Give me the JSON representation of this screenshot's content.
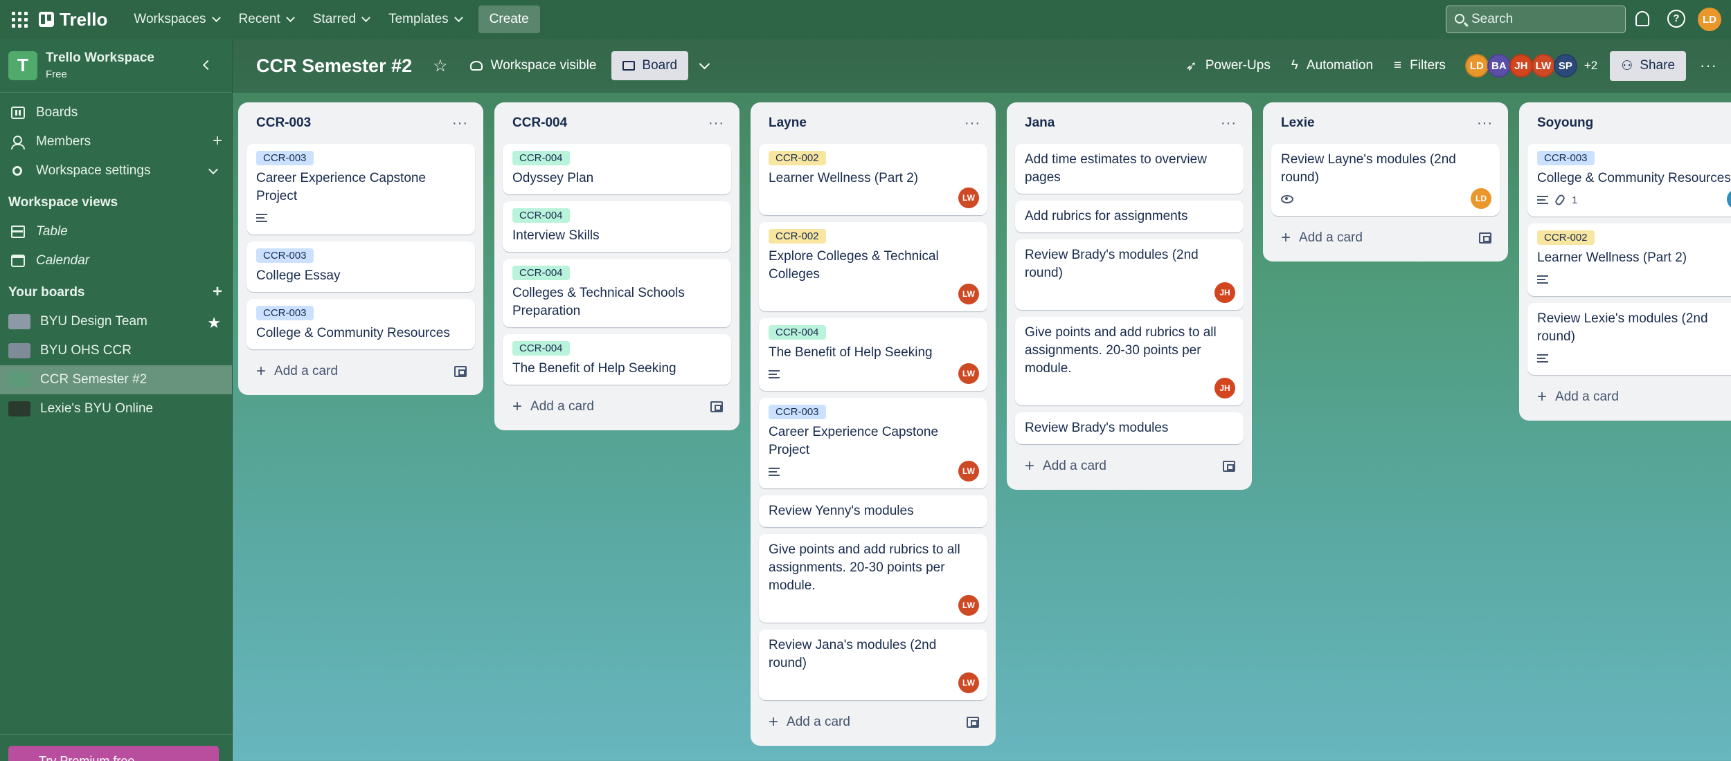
{
  "topnav": {
    "app_name": "Trello",
    "menus": [
      "Workspaces",
      "Recent",
      "Starred",
      "Templates"
    ],
    "create_label": "Create",
    "search_placeholder": "Search",
    "help_glyph": "?",
    "user_initials": "LD"
  },
  "sidebar": {
    "workspace_letter": "T",
    "workspace_name": "Trello Workspace",
    "workspace_plan": "Free",
    "items": [
      "Boards",
      "Members",
      "Workspace settings"
    ],
    "views_title": "Workspace views",
    "views": [
      "Table",
      "Calendar"
    ],
    "your_boards_title": "Your boards",
    "boards": [
      {
        "name": "BYU Design Team",
        "color": "#8d9aa6",
        "starred": true
      },
      {
        "name": "BYU OHS CCR",
        "color": "#7f8c97",
        "starred": false
      },
      {
        "name": "CCR Semester #2",
        "color": "#5c9a7a",
        "starred": false
      },
      {
        "name": "Lexie's BYU Online",
        "color": "#2b3a2e",
        "starred": false
      }
    ],
    "premium_label": "Try Premium free"
  },
  "board_header": {
    "title": "CCR Semester #2",
    "visibility": "Workspace visible",
    "view": "Board",
    "powerups": "Power-Ups",
    "automation": "Automation",
    "filters": "Filters",
    "members": [
      {
        "initials": "LD",
        "color": "#e9962b"
      },
      {
        "initials": "BA",
        "color": "#5a4ea8"
      },
      {
        "initials": "JH",
        "color": "#d3451e"
      },
      {
        "initials": "LW",
        "color": "#ce4a25"
      },
      {
        "initials": "SP",
        "color": "#2b4a7a"
      }
    ],
    "more_members": "+2",
    "share": "Share"
  },
  "lists": [
    {
      "title": "CCR-003",
      "add_card": "Add a card",
      "cards": [
        {
          "label": "CCR-003",
          "title": "Career Experience Capstone Project",
          "desc": true
        },
        {
          "label": "CCR-003",
          "title": "College Essay"
        },
        {
          "label": "CCR-003",
          "title": "College & Community Resources"
        }
      ]
    },
    {
      "title": "CCR-004",
      "add_card": "Add a card",
      "cards": [
        {
          "label": "CCR-004",
          "title": "Odyssey Plan"
        },
        {
          "label": "CCR-004",
          "title": "Interview Skills"
        },
        {
          "label": "CCR-004",
          "title": "Colleges & Technical Schools Preparation"
        },
        {
          "label": "CCR-004",
          "title": "The Benefit of Help Seeking"
        }
      ]
    },
    {
      "title": "Layne",
      "add_card": "Add a card",
      "cards": [
        {
          "label": "CCR-002",
          "title": "Learner Wellness (Part 2)",
          "member": "LW"
        },
        {
          "label": "CCR-002",
          "title": "Explore Colleges & Technical Colleges",
          "member": "LW"
        },
        {
          "label": "CCR-004",
          "title": "The Benefit of Help Seeking",
          "desc": true,
          "member": "LW"
        },
        {
          "label": "CCR-003",
          "title": "Career Experience Capstone Project",
          "desc": true,
          "member": "LW"
        },
        {
          "title": "Review Yenny's modules"
        },
        {
          "title": "Give points and add rubrics to all assignments. 20-30 points per module.",
          "member": "LW"
        },
        {
          "title": "Review Jana's modules (2nd round)",
          "member": "LW"
        }
      ]
    },
    {
      "title": "Jana",
      "add_card": "Add a card",
      "cards": [
        {
          "title": "Add time estimates to overview pages"
        },
        {
          "title": "Add rubrics for assignments"
        },
        {
          "title": "Review Brady's modules (2nd round)",
          "member": "JH"
        },
        {
          "title": "Give points and add rubrics to all assignments. 20-30 points per module.",
          "member": "JH"
        },
        {
          "title": "Review Brady's modules"
        }
      ]
    },
    {
      "title": "Lexie",
      "add_card": "Add a card",
      "cards": [
        {
          "title": "Review Layne's modules (2nd round)",
          "watch": true,
          "member": "LD"
        }
      ]
    },
    {
      "title": "Soyoung",
      "add_card": "Add a card",
      "cards": [
        {
          "label": "CCR-003",
          "title": "College & Community Resources",
          "desc": true,
          "attachments": "1",
          "member": "Y"
        },
        {
          "label": "CCR-002",
          "title": "Learner Wellness (Part 2)",
          "desc": true
        },
        {
          "title": "Review Lexie's modules (2nd round)",
          "desc": true
        }
      ]
    }
  ]
}
